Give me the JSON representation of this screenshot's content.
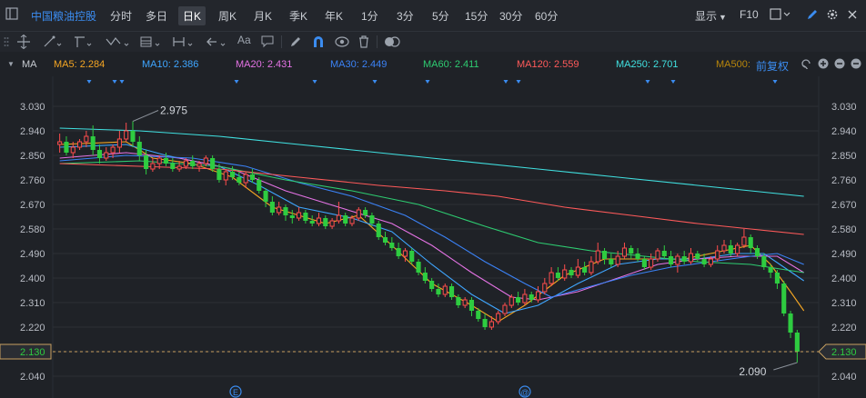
{
  "toolbar": {
    "stock_name": "中国粮油控股",
    "periods": [
      "分时",
      "多日",
      "日K",
      "周K",
      "月K",
      "季K",
      "年K",
      "1分",
      "3分",
      "5分",
      "15分",
      "30分",
      "60分"
    ],
    "active_period": "日K",
    "display_label": "显示",
    "f10_label": "F10"
  },
  "drawing_tools": {
    "text_tool_label": "Aa",
    "tools": [
      "crosshair-icon",
      "line-icon",
      "channel-icon",
      "wave-icon",
      "fib-icon",
      "range-icon",
      "arrow-icon",
      "text-icon",
      "note-icon",
      "pen-icon",
      "magnet-icon",
      "eye-icon",
      "trash-icon",
      "toggle-icon"
    ]
  },
  "indicator_bar": {
    "name": "MA",
    "items": [
      {
        "label": "MA5: 2.284",
        "color": "#f5a623"
      },
      {
        "label": "MA10: 2.386",
        "color": "#3fa6ff"
      },
      {
        "label": "MA20: 2.431",
        "color": "#e573e5"
      },
      {
        "label": "MA30: 2.449",
        "color": "#3b82f6"
      },
      {
        "label": "MA60: 2.411",
        "color": "#2ecc71"
      },
      {
        "label": "MA120: 2.559",
        "color": "#ff5a5a"
      },
      {
        "label": "MA250: 2.701",
        "color": "#40e0e0"
      },
      {
        "label": "MA500:",
        "color": "#b8860b"
      }
    ],
    "adjust_label": "前复权"
  },
  "colors": {
    "up": "#ff4d4d",
    "down": "#2ecc40",
    "background": "#1f2227",
    "grid": "#2c3036",
    "axis_text": "#b8bcc4",
    "accent": "#3b8cf0"
  },
  "chart_data": {
    "type": "candlestick",
    "yaxis_ticks": [
      "3.030",
      "2.940",
      "2.850",
      "2.760",
      "2.670",
      "2.580",
      "2.490",
      "2.400",
      "2.310",
      "2.220",
      "2.130",
      "2.040"
    ],
    "ylim": [
      2.04,
      3.03
    ],
    "current_price_label": "2.130",
    "current_price": 2.13,
    "high_annotation": "2.975",
    "high_value": 2.975,
    "low_annotation": "2.090",
    "low_value": 2.09,
    "event_markers": [
      "E",
      "@"
    ],
    "candles": [
      [
        2.89,
        2.9,
        2.93,
        2.86
      ],
      [
        2.9,
        2.86,
        2.92,
        2.85
      ],
      [
        2.86,
        2.88,
        2.9,
        2.84
      ],
      [
        2.88,
        2.9,
        2.91,
        2.87
      ],
      [
        2.9,
        2.92,
        2.94,
        2.88
      ],
      [
        2.92,
        2.87,
        2.96,
        2.85
      ],
      [
        2.87,
        2.84,
        2.89,
        2.82
      ],
      [
        2.84,
        2.86,
        2.88,
        2.83
      ],
      [
        2.86,
        2.88,
        2.89,
        2.84
      ],
      [
        2.88,
        2.91,
        2.94,
        2.86
      ],
      [
        2.91,
        2.94,
        2.97,
        2.9
      ],
      [
        2.94,
        2.9,
        2.975,
        2.88
      ],
      [
        2.9,
        2.85,
        2.92,
        2.83
      ],
      [
        2.85,
        2.8,
        2.87,
        2.78
      ],
      [
        2.8,
        2.82,
        2.84,
        2.79
      ],
      [
        2.82,
        2.84,
        2.85,
        2.8
      ],
      [
        2.84,
        2.82,
        2.86,
        2.81
      ],
      [
        2.82,
        2.8,
        2.84,
        2.79
      ],
      [
        2.8,
        2.81,
        2.83,
        2.79
      ],
      [
        2.81,
        2.83,
        2.84,
        2.8
      ],
      [
        2.83,
        2.81,
        2.85,
        2.8
      ],
      [
        2.81,
        2.82,
        2.83,
        2.79
      ],
      [
        2.82,
        2.84,
        2.85,
        2.81
      ],
      [
        2.84,
        2.8,
        2.85,
        2.79
      ],
      [
        2.8,
        2.76,
        2.82,
        2.75
      ],
      [
        2.76,
        2.79,
        2.8,
        2.74
      ],
      [
        2.79,
        2.77,
        2.81,
        2.76
      ],
      [
        2.77,
        2.75,
        2.79,
        2.74
      ],
      [
        2.75,
        2.78,
        2.79,
        2.73
      ],
      [
        2.78,
        2.76,
        2.8,
        2.75
      ],
      [
        2.76,
        2.72,
        2.77,
        2.71
      ],
      [
        2.72,
        2.68,
        2.73,
        2.66
      ],
      [
        2.68,
        2.64,
        2.7,
        2.63
      ],
      [
        2.64,
        2.66,
        2.68,
        2.63
      ],
      [
        2.66,
        2.63,
        2.67,
        2.61
      ],
      [
        2.63,
        2.62,
        2.65,
        2.6
      ],
      [
        2.62,
        2.64,
        2.66,
        2.61
      ],
      [
        2.64,
        2.61,
        2.65,
        2.6
      ],
      [
        2.61,
        2.6,
        2.63,
        2.59
      ],
      [
        2.6,
        2.62,
        2.64,
        2.59
      ],
      [
        2.62,
        2.59,
        2.63,
        2.58
      ],
      [
        2.59,
        2.61,
        2.62,
        2.58
      ],
      [
        2.61,
        2.63,
        2.68,
        2.6
      ],
      [
        2.63,
        2.6,
        2.64,
        2.59
      ],
      [
        2.6,
        2.62,
        2.63,
        2.59
      ],
      [
        2.62,
        2.65,
        2.66,
        2.61
      ],
      [
        2.65,
        2.63,
        2.66,
        2.62
      ],
      [
        2.63,
        2.6,
        2.64,
        2.59
      ],
      [
        2.6,
        2.55,
        2.61,
        2.54
      ],
      [
        2.55,
        2.53,
        2.57,
        2.52
      ],
      [
        2.53,
        2.51,
        2.55,
        2.5
      ],
      [
        2.51,
        2.48,
        2.53,
        2.47
      ],
      [
        2.48,
        2.5,
        2.51,
        2.46
      ],
      [
        2.5,
        2.46,
        2.51,
        2.45
      ],
      [
        2.46,
        2.42,
        2.47,
        2.41
      ],
      [
        2.42,
        2.39,
        2.44,
        2.38
      ],
      [
        2.39,
        2.36,
        2.4,
        2.35
      ],
      [
        2.36,
        2.34,
        2.38,
        2.33
      ],
      [
        2.34,
        2.37,
        2.38,
        2.33
      ],
      [
        2.37,
        2.33,
        2.38,
        2.32
      ],
      [
        2.33,
        2.3,
        2.34,
        2.29
      ],
      [
        2.3,
        2.32,
        2.33,
        2.29
      ],
      [
        2.32,
        2.28,
        2.33,
        2.26
      ],
      [
        2.28,
        2.25,
        2.29,
        2.24
      ],
      [
        2.25,
        2.22,
        2.27,
        2.21
      ],
      [
        2.22,
        2.24,
        2.26,
        2.21
      ],
      [
        2.24,
        2.27,
        2.28,
        2.23
      ],
      [
        2.27,
        2.3,
        2.31,
        2.26
      ],
      [
        2.3,
        2.33,
        2.34,
        2.29
      ],
      [
        2.33,
        2.31,
        2.35,
        2.3
      ],
      [
        2.31,
        2.34,
        2.36,
        2.3
      ],
      [
        2.34,
        2.32,
        2.35,
        2.31
      ],
      [
        2.32,
        2.35,
        2.37,
        2.31
      ],
      [
        2.35,
        2.38,
        2.4,
        2.34
      ],
      [
        2.38,
        2.42,
        2.44,
        2.37
      ],
      [
        2.42,
        2.4,
        2.44,
        2.39
      ],
      [
        2.4,
        2.43,
        2.45,
        2.39
      ],
      [
        2.43,
        2.41,
        2.44,
        2.4
      ],
      [
        2.41,
        2.44,
        2.47,
        2.4
      ],
      [
        2.44,
        2.42,
        2.46,
        2.41
      ],
      [
        2.42,
        2.46,
        2.48,
        2.41
      ],
      [
        2.46,
        2.5,
        2.53,
        2.45
      ],
      [
        2.5,
        2.47,
        2.51,
        2.45
      ],
      [
        2.47,
        2.45,
        2.49,
        2.44
      ],
      [
        2.45,
        2.48,
        2.5,
        2.44
      ],
      [
        2.48,
        2.51,
        2.53,
        2.47
      ],
      [
        2.51,
        2.49,
        2.52,
        2.47
      ],
      [
        2.49,
        2.47,
        2.51,
        2.46
      ],
      [
        2.47,
        2.44,
        2.48,
        2.43
      ],
      [
        2.44,
        2.47,
        2.49,
        2.43
      ],
      [
        2.47,
        2.5,
        2.51,
        2.46
      ],
      [
        2.5,
        2.48,
        2.52,
        2.47
      ],
      [
        2.48,
        2.45,
        2.5,
        2.44
      ],
      [
        2.45,
        2.48,
        2.49,
        2.42
      ],
      [
        2.48,
        2.46,
        2.5,
        2.45
      ],
      [
        2.46,
        2.49,
        2.51,
        2.45
      ],
      [
        2.49,
        2.47,
        2.5,
        2.46
      ],
      [
        2.47,
        2.45,
        2.49,
        2.44
      ],
      [
        2.45,
        2.47,
        2.48,
        2.44
      ],
      [
        2.47,
        2.5,
        2.52,
        2.46
      ],
      [
        2.5,
        2.52,
        2.54,
        2.49
      ],
      [
        2.52,
        2.49,
        2.54,
        2.48
      ],
      [
        2.49,
        2.52,
        2.53,
        2.48
      ],
      [
        2.52,
        2.55,
        2.58,
        2.51
      ],
      [
        2.55,
        2.51,
        2.56,
        2.49
      ],
      [
        2.51,
        2.48,
        2.52,
        2.47
      ],
      [
        2.48,
        2.44,
        2.49,
        2.43
      ],
      [
        2.44,
        2.42,
        2.45,
        2.4
      ],
      [
        2.42,
        2.38,
        2.43,
        2.36
      ],
      [
        2.38,
        2.27,
        2.39,
        2.26
      ],
      [
        2.27,
        2.2,
        2.28,
        2.18
      ],
      [
        2.2,
        2.13,
        2.21,
        2.09
      ]
    ],
    "ma_series": [
      {
        "name": "MA5",
        "color": "#f5a623",
        "points": [
          [
            0,
            2.89
          ],
          [
            10,
            2.9
          ],
          [
            14,
            2.84
          ],
          [
            20,
            2.82
          ],
          [
            26,
            2.77
          ],
          [
            32,
            2.66
          ],
          [
            40,
            2.6
          ],
          [
            45,
            2.63
          ],
          [
            50,
            2.52
          ],
          [
            56,
            2.38
          ],
          [
            62,
            2.3
          ],
          [
            66,
            2.24
          ],
          [
            70,
            2.3
          ],
          [
            76,
            2.41
          ],
          [
            82,
            2.47
          ],
          [
            88,
            2.47
          ],
          [
            94,
            2.47
          ],
          [
            100,
            2.5
          ],
          [
            104,
            2.52
          ],
          [
            107,
            2.45
          ],
          [
            110,
            2.35
          ],
          [
            112,
            2.28
          ]
        ]
      },
      {
        "name": "MA10",
        "color": "#3fa6ff",
        "points": [
          [
            0,
            2.88
          ],
          [
            10,
            2.89
          ],
          [
            16,
            2.85
          ],
          [
            24,
            2.81
          ],
          [
            30,
            2.74
          ],
          [
            36,
            2.66
          ],
          [
            44,
            2.62
          ],
          [
            50,
            2.57
          ],
          [
            56,
            2.45
          ],
          [
            62,
            2.34
          ],
          [
            67,
            2.27
          ],
          [
            72,
            2.3
          ],
          [
            78,
            2.38
          ],
          [
            84,
            2.45
          ],
          [
            90,
            2.47
          ],
          [
            96,
            2.47
          ],
          [
            102,
            2.49
          ],
          [
            106,
            2.49
          ],
          [
            109,
            2.44
          ],
          [
            112,
            2.39
          ]
        ]
      },
      {
        "name": "MA20",
        "color": "#e573e5",
        "points": [
          [
            0,
            2.84
          ],
          [
            10,
            2.86
          ],
          [
            18,
            2.84
          ],
          [
            26,
            2.8
          ],
          [
            34,
            2.72
          ],
          [
            42,
            2.66
          ],
          [
            50,
            2.6
          ],
          [
            56,
            2.52
          ],
          [
            62,
            2.42
          ],
          [
            68,
            2.33
          ],
          [
            72,
            2.32
          ],
          [
            78,
            2.35
          ],
          [
            84,
            2.4
          ],
          [
            90,
            2.45
          ],
          [
            96,
            2.47
          ],
          [
            102,
            2.48
          ],
          [
            108,
            2.48
          ],
          [
            112,
            2.42
          ]
        ]
      },
      {
        "name": "MA30",
        "color": "#3b82f6",
        "points": [
          [
            0,
            2.83
          ],
          [
            10,
            2.85
          ],
          [
            20,
            2.84
          ],
          [
            28,
            2.81
          ],
          [
            36,
            2.75
          ],
          [
            44,
            2.7
          ],
          [
            52,
            2.63
          ],
          [
            58,
            2.55
          ],
          [
            64,
            2.46
          ],
          [
            70,
            2.38
          ],
          [
            74,
            2.33
          ],
          [
            80,
            2.37
          ],
          [
            86,
            2.41
          ],
          [
            92,
            2.44
          ],
          [
            98,
            2.46
          ],
          [
            104,
            2.48
          ],
          [
            108,
            2.49
          ],
          [
            112,
            2.45
          ]
        ]
      },
      {
        "name": "MA60",
        "color": "#2ecc71",
        "points": [
          [
            0,
            2.82
          ],
          [
            12,
            2.83
          ],
          [
            24,
            2.81
          ],
          [
            34,
            2.76
          ],
          [
            44,
            2.72
          ],
          [
            54,
            2.67
          ],
          [
            64,
            2.59
          ],
          [
            72,
            2.53
          ],
          [
            80,
            2.5
          ],
          [
            88,
            2.48
          ],
          [
            96,
            2.46
          ],
          [
            104,
            2.45
          ],
          [
            112,
            2.42
          ]
        ]
      },
      {
        "name": "MA120",
        "color": "#ff5a5a",
        "points": [
          [
            0,
            2.82
          ],
          [
            12,
            2.81
          ],
          [
            24,
            2.8
          ],
          [
            36,
            2.77
          ],
          [
            48,
            2.74
          ],
          [
            58,
            2.72
          ],
          [
            66,
            2.7
          ],
          [
            76,
            2.66
          ],
          [
            86,
            2.63
          ],
          [
            96,
            2.6
          ],
          [
            104,
            2.58
          ],
          [
            112,
            2.56
          ]
        ]
      },
      {
        "name": "MA250",
        "color": "#40e0e0",
        "points": [
          [
            0,
            2.95
          ],
          [
            12,
            2.94
          ],
          [
            24,
            2.92
          ],
          [
            36,
            2.89
          ],
          [
            48,
            2.86
          ],
          [
            60,
            2.83
          ],
          [
            72,
            2.8
          ],
          [
            84,
            2.77
          ],
          [
            96,
            2.74
          ],
          [
            112,
            2.7
          ]
        ]
      }
    ]
  }
}
